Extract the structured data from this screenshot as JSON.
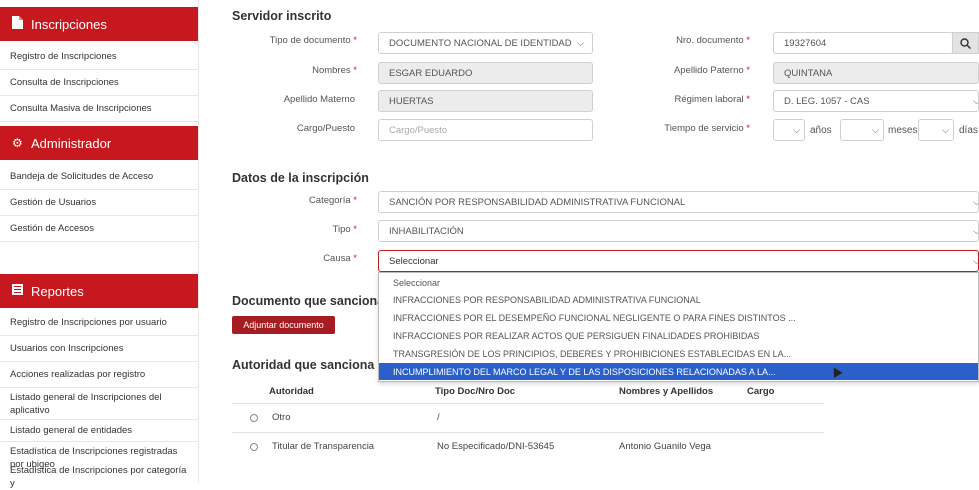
{
  "sidebar": {
    "inscripciones": {
      "header": "Inscripciones",
      "icon": "document-icon",
      "items": [
        "Registro de Inscripciones",
        "Consulta de Inscripciones",
        "Consulta Masiva de Inscripciones"
      ]
    },
    "administrador": {
      "header": "Administrador",
      "icon": "gear-icon",
      "items": [
        "Bandeja de Solicitudes de Acceso",
        "Gestión de Usuarios",
        "Gestión de Accesos"
      ]
    },
    "reportes": {
      "header": "Reportes",
      "icon": "list-icon",
      "items": [
        "Registro de Inscripciones por usuario",
        "Usuarios con Inscripciones",
        "Acciones realizadas por registro",
        "Listado general de Inscripciones del aplicativo",
        "Listado general de entidades",
        "Estadística de Inscripciones registradas por ubigeo",
        "Estadística de Inscripciones por categoría y"
      ]
    }
  },
  "servidor": {
    "title": "Servidor inscrito",
    "tipo_doc_label": "Tipo de documento",
    "tipo_doc_value": "DOCUMENTO NACIONAL DE IDENTIDAD",
    "nro_doc_label": "Nro. documento",
    "nro_doc_value": "19327604",
    "nombres_label": "Nombres",
    "nombres_value": "ESGAR EDUARDO",
    "ap_paterno_label": "Apellido Paterno",
    "ap_paterno_value": "QUINTANA",
    "ap_materno_label": "Apellido Materno",
    "ap_materno_value": "HUERTAS",
    "regimen_label": "Régimen laboral",
    "regimen_value": "D. LEG. 1057 - CAS",
    "cargo_label": "Cargo/Puesto",
    "cargo_placeholder": "Cargo/Puesto",
    "tiempo_label": "Tiempo de servicio",
    "anios_label": "años",
    "meses_label": "meses",
    "dias_label": "días",
    "required_mark": "*"
  },
  "inscripcion": {
    "title": "Datos de la inscripción",
    "categoria_label": "Categoría",
    "categoria_value": "SANCIÓN POR RESPONSABILIDAD ADMINISTRATIVA FUNCIONAL",
    "tipo_label": "Tipo",
    "tipo_value": "INHABILITACIÓN",
    "causa_label": "Causa",
    "causa_value": "Seleccionar",
    "causa_options": [
      "Seleccionar",
      "INFRACCIONES POR RESPONSABILIDAD ADMINISTRATIVA FUNCIONAL",
      "INFRACCIONES POR EL DESEMPEÑO FUNCIONAL NEGLIGENTE O PARA FINES DISTINTOS ...",
      "INFRACCIONES POR REALIZAR ACTOS QUE PERSIGUEN FINALIDADES PROHIBIDAS",
      "TRANSGRESIÓN DE LOS PRINCIPIOS, DEBERES Y PROHIBICIONES ESTABLECIDAS EN LA...",
      "INCUMPLIMIENTO DEL MARCO LEGAL Y DE LAS DISPOSICIONES RELACIONADAS A LA..."
    ],
    "highlighted_option": 5
  },
  "documento": {
    "title": "Documento que sanciona (",
    "button": "Adjuntar documento"
  },
  "autoridad": {
    "title": "Autoridad que sanciona",
    "columns": [
      "Autoridad",
      "Tipo Doc/Nro Doc",
      "Nombres y Apellidos",
      "Cargo"
    ],
    "rows": [
      {
        "autoridad": "Otro",
        "doc": "/",
        "nombres": "",
        "cargo": ""
      },
      {
        "autoridad": "Titular de Transparencia",
        "doc": "No Especificado/DNI-53645",
        "nombres": "Antonio Guanilo Vega",
        "cargo": ""
      }
    ]
  },
  "colors": {
    "brand_red": "#c7181f",
    "highlight_blue": "#2b5fc9"
  }
}
